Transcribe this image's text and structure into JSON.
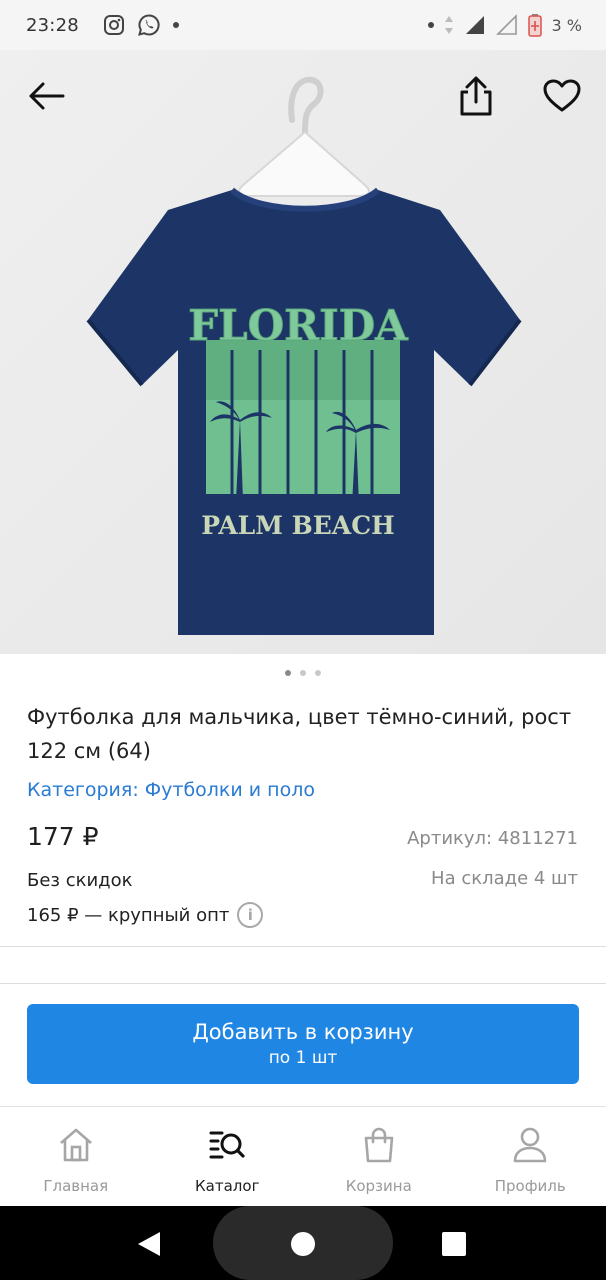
{
  "status_bar": {
    "time": "23:28",
    "battery_percent": "3 %",
    "icons": [
      "instagram-icon",
      "whatsapp-icon",
      "notification-dot",
      "signal-icon",
      "battery-icon"
    ]
  },
  "hero": {
    "back_icon": "arrow-left-icon",
    "share_icon": "share-icon",
    "favorite_icon": "heart-icon",
    "image_alt": "navy t-shirt with FLORIDA PALM BEACH print",
    "print_top": "FLORIDA",
    "print_bottom": "PALM BEACH",
    "pager": {
      "count": 3,
      "active_index": 0
    }
  },
  "product": {
    "title": "Футболка для мальчика, цвет тёмно-синий, рост 122 см (64)",
    "category": "Категория: Футболки и поло",
    "price": "177 ₽",
    "sku": "Артикул: 4811271",
    "discount_note": "Без скидок",
    "stock": "На складе 4 шт",
    "wholesale": "165 ₽ — крупный опт",
    "info_glyph": "i"
  },
  "cart_button": {
    "label": "Добавить в корзину",
    "sublabel": "по 1 шт"
  },
  "bottom_nav": {
    "items": [
      {
        "label": "Главная",
        "icon": "home-icon",
        "active": false
      },
      {
        "label": "Каталог",
        "icon": "catalog-search-icon",
        "active": true
      },
      {
        "label": "Корзина",
        "icon": "cart-bag-icon",
        "active": false
      },
      {
        "label": "Профиль",
        "icon": "profile-icon",
        "active": false
      }
    ]
  },
  "colors": {
    "accent": "#1f86e3",
    "link": "#2a7bd4",
    "shirt": "#1c3466",
    "print": "#7fc99a"
  }
}
